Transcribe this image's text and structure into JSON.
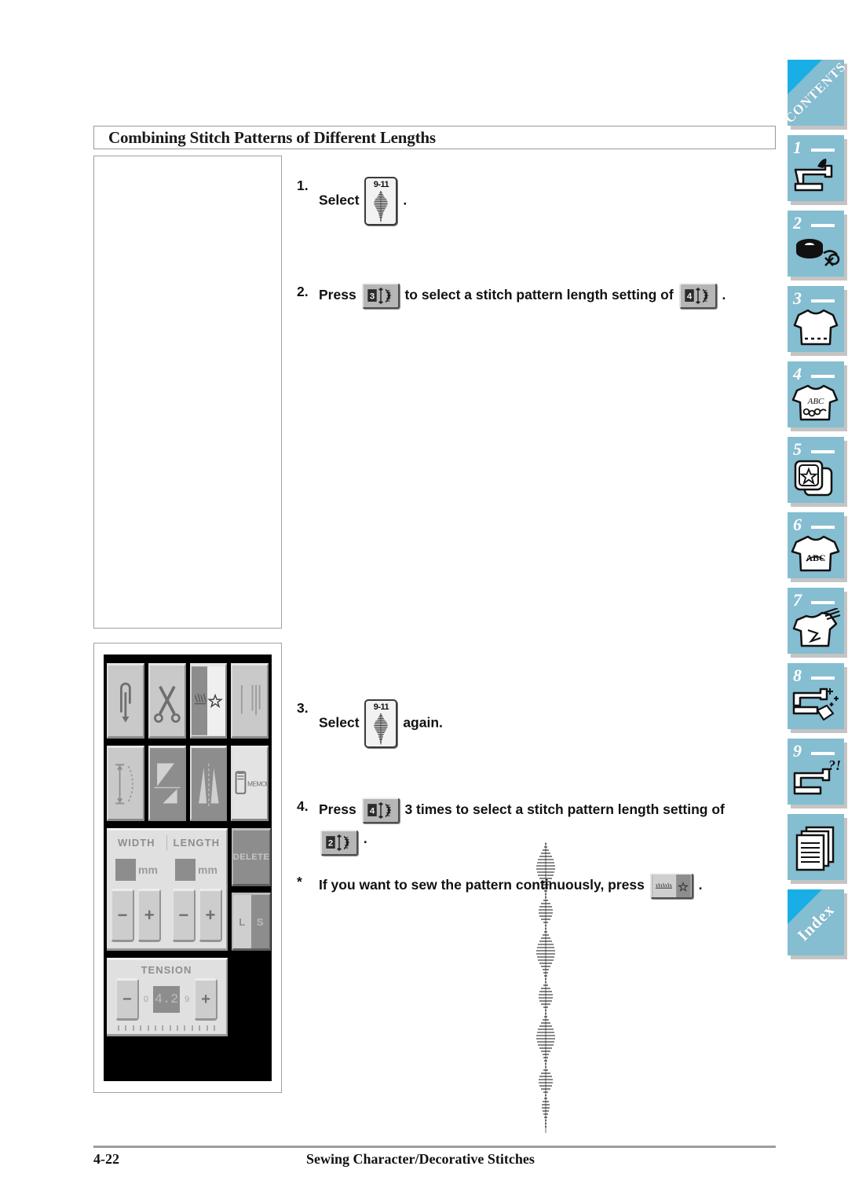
{
  "page": {
    "section_title": "Combining Stitch Patterns of Different Lengths",
    "footer_page_number": "4-22",
    "footer_chapter_title": "Sewing Character/Decorative Stitches",
    "accent_color": "#85bdd1",
    "accent_corner_color": "#19aee5",
    "tab_shadow_color": "#c4c4c4"
  },
  "steps": [
    {
      "number": "1.",
      "text_before": "Select",
      "key": {
        "type": "pattern-key",
        "label": "9-11",
        "icon": "leaf-stitch-pattern-icon"
      },
      "text_after": "."
    },
    {
      "number": "2.",
      "text_before": "Press",
      "key": {
        "type": "length-key",
        "label": "3",
        "icon": "stitch-length-3-icon"
      },
      "text_middle": "to select a stitch pattern length setting of",
      "key2": {
        "type": "length-key",
        "label": "4",
        "icon": "stitch-length-4-icon"
      },
      "text_after": "."
    },
    {
      "number": "3.",
      "text_before": "Select",
      "key": {
        "type": "pattern-key",
        "label": "9-11",
        "icon": "leaf-stitch-pattern-icon"
      },
      "text_after": "again."
    },
    {
      "number": "4.",
      "text_before": "Press",
      "key": {
        "type": "length-key",
        "label": "4",
        "icon": "stitch-length-4-icon"
      },
      "text_middle": "3 times to select a stitch pattern length setting of",
      "key2": {
        "type": "length-key",
        "label": "2",
        "icon": "stitch-length-2-icon"
      },
      "text_after": "."
    },
    {
      "number": "*",
      "text_before": "If you want to sew the pattern continuously, press",
      "key": {
        "type": "continuous-key",
        "icon": "continuous-sewing-icon"
      },
      "text_after": "."
    }
  ],
  "lcd_panel": {
    "row1_keys": [
      {
        "name": "needle-position-key",
        "icon": "needle-up-down-icon",
        "state": "normal"
      },
      {
        "name": "thread-cutter-key",
        "icon": "scissors-icon",
        "state": "normal"
      },
      {
        "name": "pattern-select-key",
        "icon": "pattern-star-icon",
        "state": "selected"
      },
      {
        "name": "stitch-preview-key",
        "icon": "stitch-lines-icon",
        "state": "normal"
      }
    ],
    "row2_keys": [
      {
        "name": "stitch-length-key",
        "icon": "length-arrow-icon",
        "state": "normal"
      },
      {
        "name": "mirror-image-key",
        "icon": "mirror-triangle-icon",
        "state": "active"
      },
      {
        "name": "elongation-key",
        "icon": "elongation-icon",
        "state": "active"
      },
      {
        "name": "memory-key",
        "icon": "memory-icon",
        "label": "MEMORY",
        "state": "normal"
      }
    ],
    "width": {
      "label": "WIDTH",
      "value": "",
      "unit": "mm",
      "minus": "−",
      "plus": "+"
    },
    "length": {
      "label": "LENGTH",
      "value": "",
      "unit": "mm",
      "minus": "−",
      "plus": "+"
    },
    "delete_button": "DELETE",
    "ls_button": {
      "left": "L",
      "right": "S"
    },
    "tension": {
      "label": "TENSION",
      "value": "4.2",
      "minus": "−",
      "plus": "+",
      "scale_min": "0",
      "scale_max": "9"
    }
  },
  "sidebar": {
    "tabs": [
      {
        "name": "tab-contents",
        "label": "CONTENTS",
        "style": "diagonal"
      },
      {
        "name": "tab-1",
        "number": "1",
        "icon": "sewing-machine-needle-icon"
      },
      {
        "name": "tab-2",
        "number": "2",
        "icon": "bobbin-thread-icon"
      },
      {
        "name": "tab-3",
        "number": "3",
        "icon": "shirt-dashed-hem-icon"
      },
      {
        "name": "tab-4",
        "number": "4",
        "icon": "shirt-abc-decorative-icon"
      },
      {
        "name": "tab-5",
        "number": "5",
        "icon": "embroidery-frame-star-icon"
      },
      {
        "name": "tab-6",
        "number": "6",
        "icon": "shirt-abc-lettering-icon"
      },
      {
        "name": "tab-7",
        "number": "7",
        "icon": "shirt-needle-repair-icon"
      },
      {
        "name": "tab-8",
        "number": "8",
        "icon": "sewing-machine-cleaning-icon"
      },
      {
        "name": "tab-9",
        "number": "9",
        "icon": "sewing-machine-question-icon"
      },
      {
        "name": "tab-reference",
        "icon": "documents-stack-icon"
      },
      {
        "name": "tab-index",
        "label": "Index",
        "style": "diagonal"
      }
    ]
  }
}
